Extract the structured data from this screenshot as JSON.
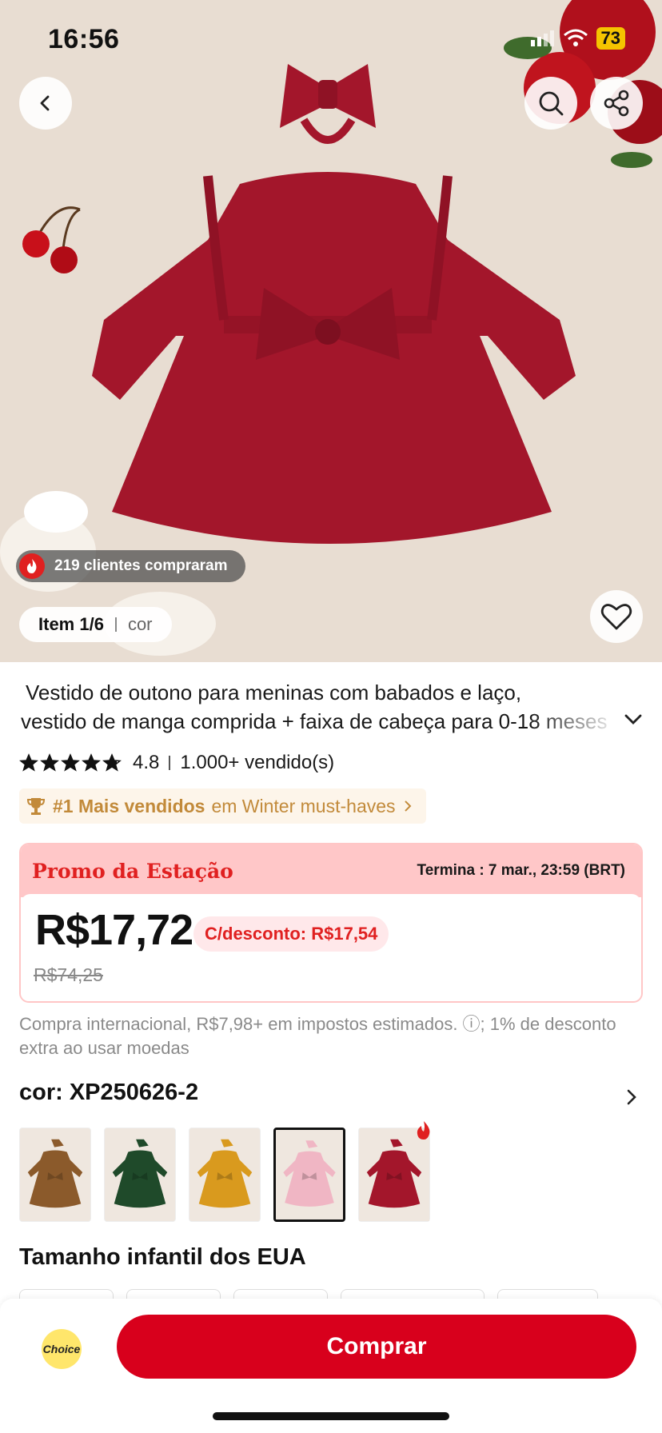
{
  "status_bar": {
    "time": "16:56",
    "battery": "73"
  },
  "gallery": {
    "bought_badge": "219 clientes compraram",
    "item_counter": "Item 1/6",
    "item_label": "cor"
  },
  "product": {
    "title_line1": "Vestido de outono para meninas com babados e laço,",
    "title_line2": "vestido de manga comprida + faixa de cabeça para 0-18 meses",
    "rating": "4.8",
    "rating_stars": 4.8,
    "sold": "1.000+ vendido(s)",
    "rank_strong": "#1 Mais vendidos",
    "rank_rest": "em Winter must-haves"
  },
  "promo": {
    "title": "Promo da Estação",
    "ends": "Termina : 7 mar., 23:59 (BRT)",
    "price": "R$17,72",
    "discount": "C/desconto: R$17,54",
    "old_price": "R$74,25"
  },
  "tax_note": "Compra internacional, R$7,98+ em impostos estimados. ⓘ; 1% de desconto extra ao usar moedas",
  "color": {
    "heading": "cor: XP250626-2",
    "swatches": [
      "#8b5a2b",
      "#1f4a2a",
      "#d99a1e",
      "#f0b6c4",
      "#a3162b"
    ],
    "selected_index": 3
  },
  "size": {
    "heading": "Tamanho infantil dos EUA"
  },
  "bottom_bar": {
    "choice_label": "Choice",
    "buy_label": "Comprar"
  },
  "colors": {
    "accent": "#d8001c",
    "promo_bg": "#ffc7c8",
    "rank_gold": "#c28a3a"
  }
}
